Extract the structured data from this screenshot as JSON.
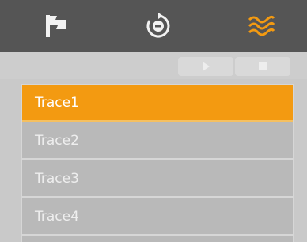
{
  "tabs": [
    {
      "icon": "flag-icon",
      "active": false
    },
    {
      "icon": "rotate-icon",
      "active": false
    },
    {
      "icon": "waves-icon",
      "active": true
    }
  ],
  "colors": {
    "tabbar_bg": "#555555",
    "accent": "#f39a11",
    "icon_inactive": "#f2f2f2",
    "list_bg": "#b9b9b9",
    "row_text": "#eeeeee"
  },
  "toolbar": {
    "play_icon": "play-icon",
    "stop_icon": "stop-icon"
  },
  "traces": [
    {
      "label": "Trace1",
      "selected": true
    },
    {
      "label": "Trace2",
      "selected": false
    },
    {
      "label": "Trace3",
      "selected": false
    },
    {
      "label": "Trace4",
      "selected": false
    }
  ]
}
